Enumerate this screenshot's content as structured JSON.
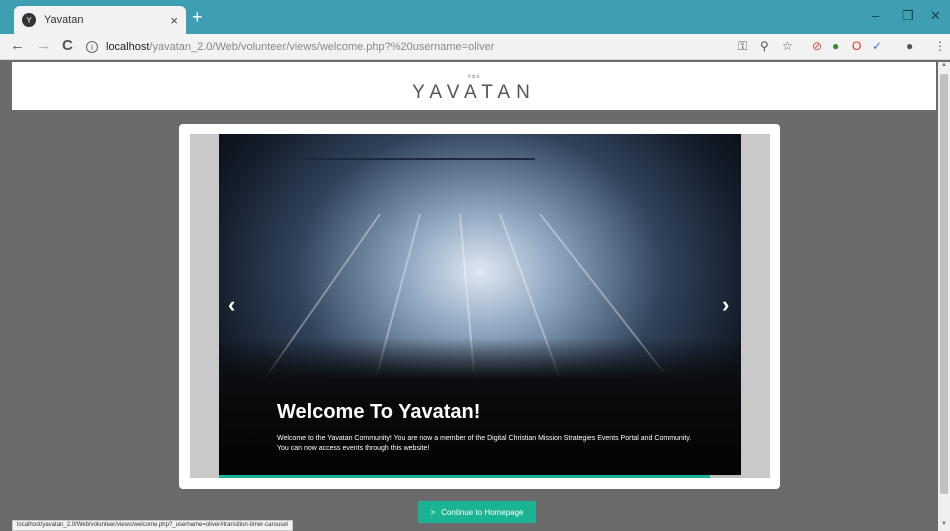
{
  "browser": {
    "tab_title": "Yavatan",
    "tab_close": "×",
    "new_tab": "+",
    "favicon": "Y",
    "window_minimize": "–",
    "window_restore": "❐",
    "window_close": "✕",
    "url_host": "localhost",
    "url_path": "/yavatan_2.0/Web/volunteer/views/welcome.php?%20username=oliver",
    "back": "←",
    "forward": "→",
    "reload": "C",
    "info": "i"
  },
  "header": {
    "logo_mark": "ᴙᴓᴕ",
    "logo_text": "YAVATAN"
  },
  "carousel": {
    "title": "Welcome To Yavatan!",
    "text": "Welcome to the Yavatan Community! You are now a member of the Digital Christian Mission Strategies Events Portal and Community. You can now access events through this website!",
    "prev": "‹",
    "next": "›",
    "progress": 0.94
  },
  "cta": {
    "label": "Continue to Homepage",
    "chevron": ">"
  },
  "statusbar": {
    "text": "localhost/yavatan_2.0/Web/volunteer/views/welcome.php?_username=oliver#transition-timer-carousel"
  },
  "colors": {
    "tabbar": "#3e9fb2",
    "accent": "#1ab394"
  }
}
